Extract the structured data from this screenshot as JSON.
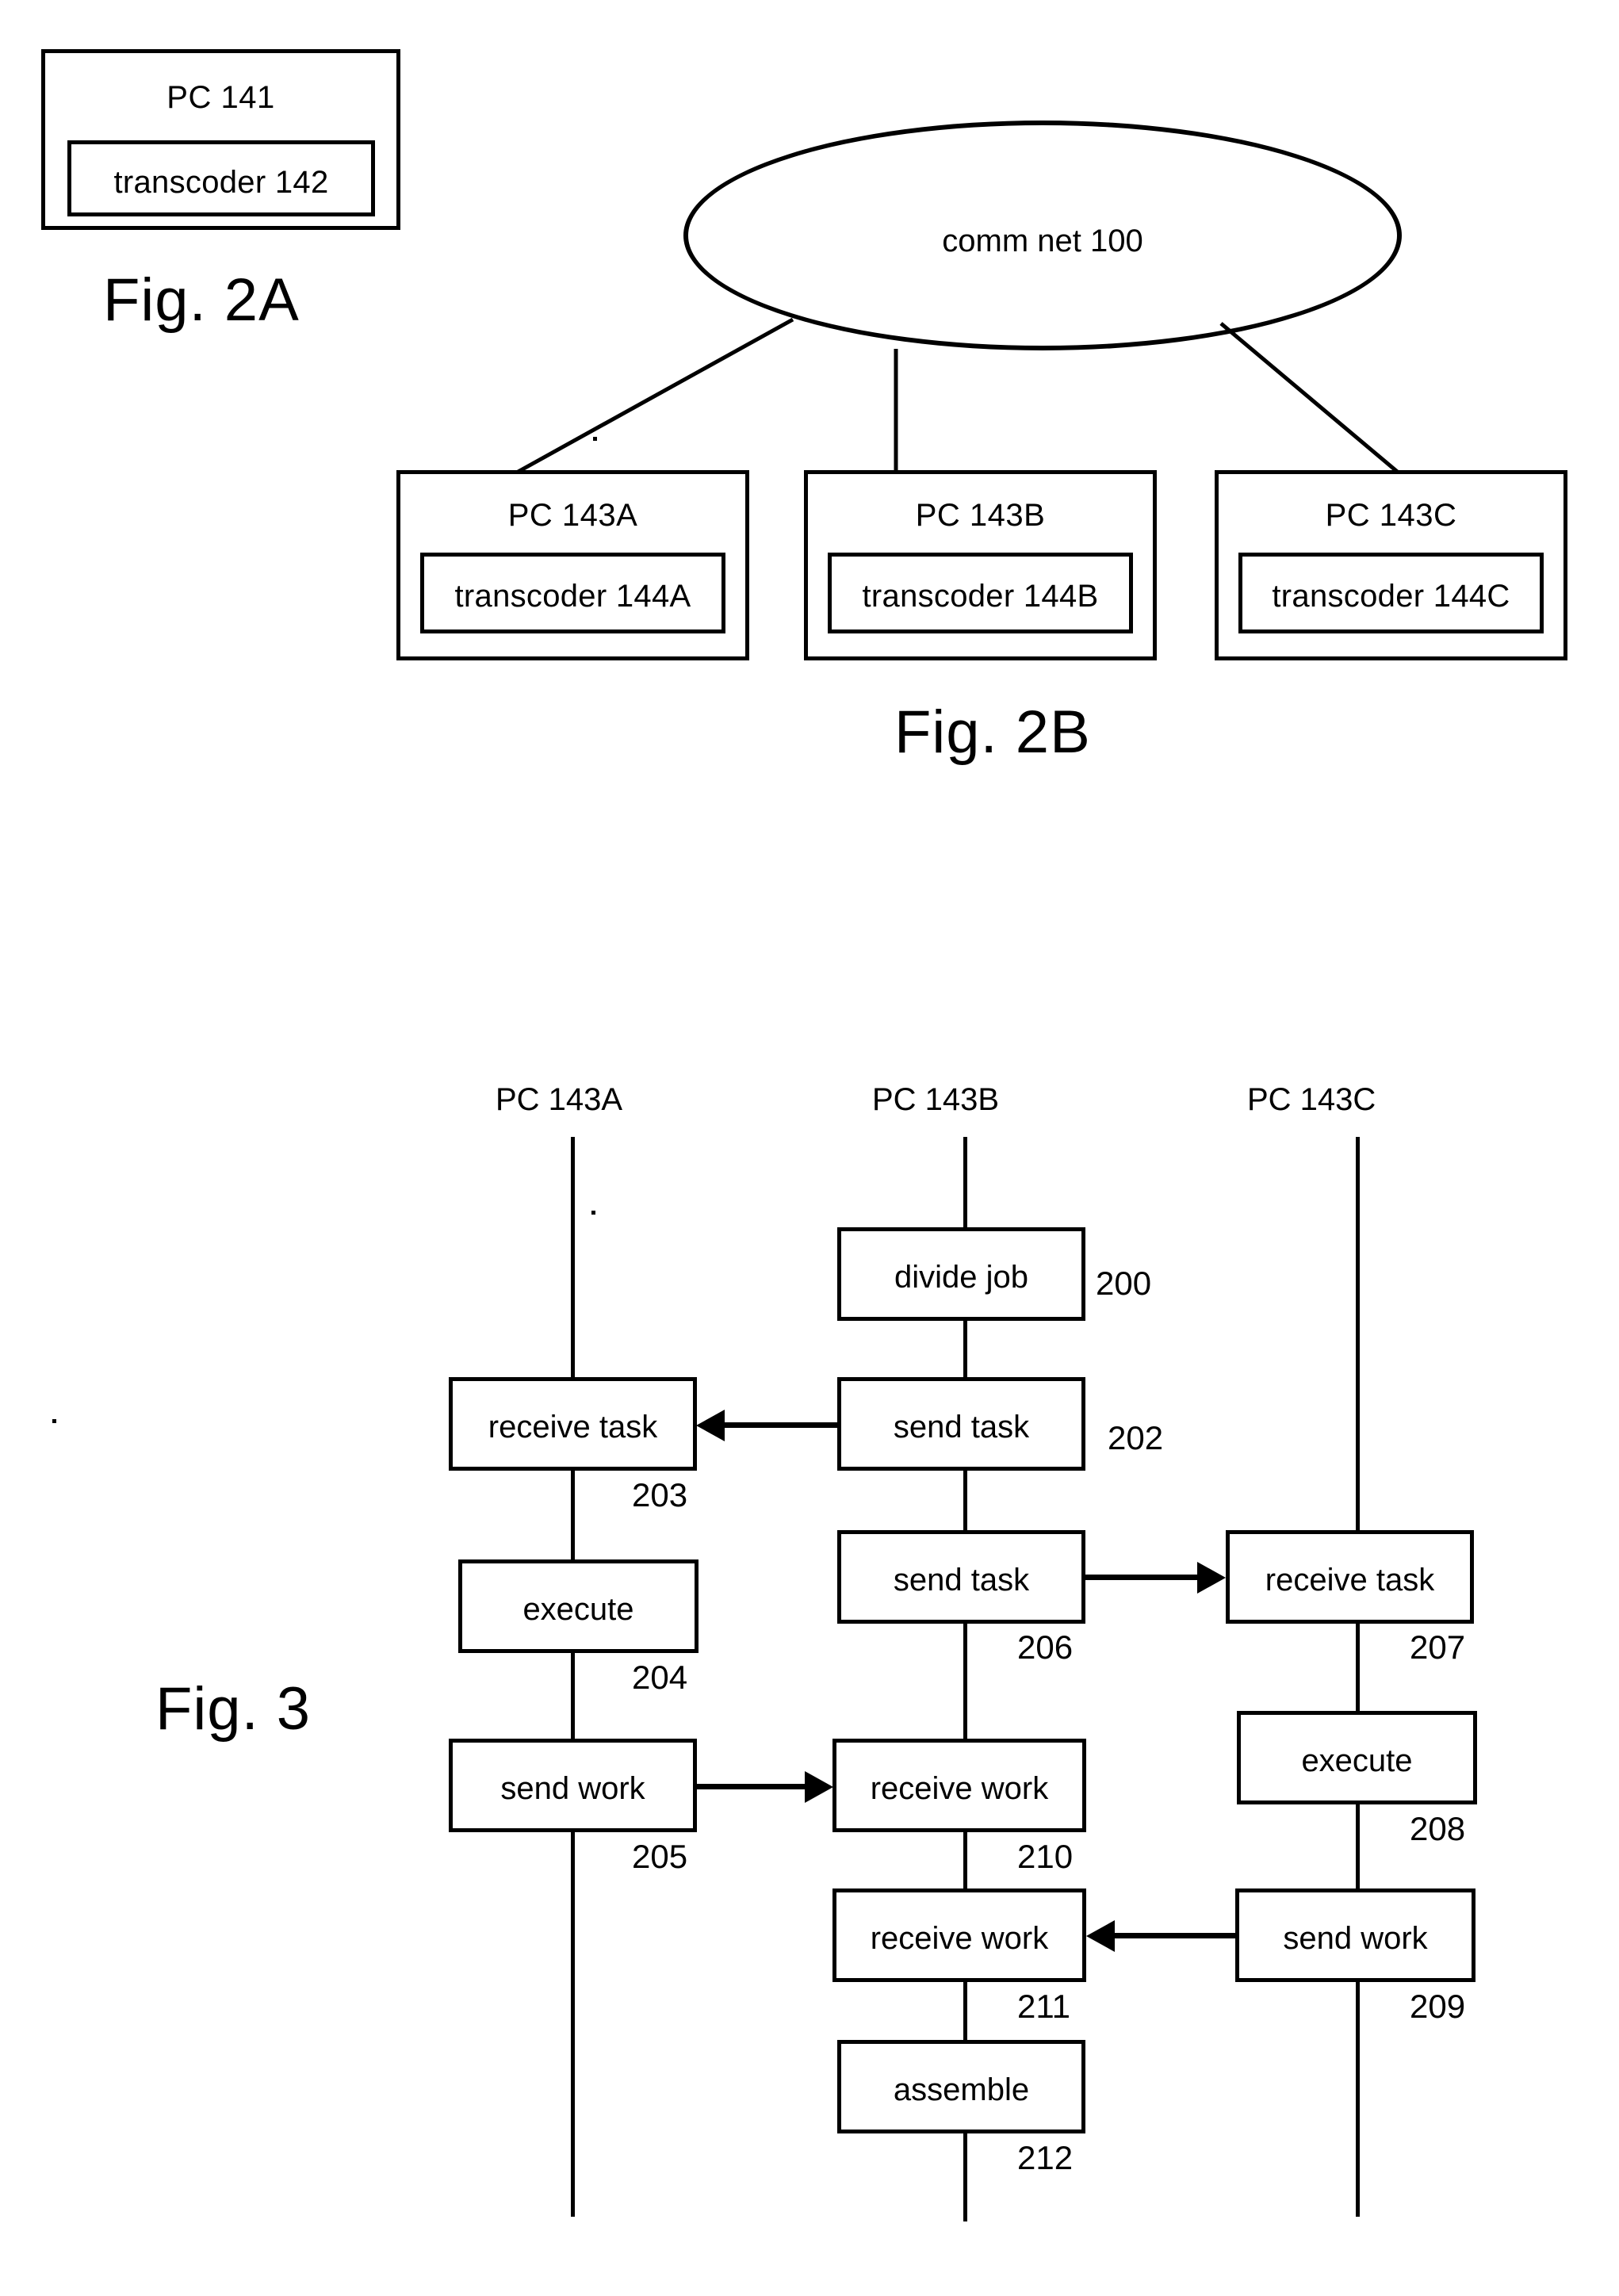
{
  "figures": {
    "fig2a": {
      "caption": "Fig. 2A",
      "pc": {
        "label": "PC 141"
      },
      "transcoder": {
        "label": "transcoder 142"
      }
    },
    "fig2b": {
      "caption": "Fig. 2B",
      "network": {
        "label": "comm net 100"
      },
      "nodes": [
        {
          "pc_label": "PC 143A",
          "transcoder_label": "transcoder 144A"
        },
        {
          "pc_label": "PC 143B",
          "transcoder_label": "transcoder 144B"
        },
        {
          "pc_label": "PC 143C",
          "transcoder_label": "transcoder 144C"
        }
      ]
    },
    "fig3": {
      "caption": "Fig. 3",
      "lifelines": [
        {
          "label": "PC 143A"
        },
        {
          "label": "PC 143B"
        },
        {
          "label": "PC 143C"
        }
      ],
      "steps": [
        {
          "label": "divide job",
          "ref": "200",
          "lifeline": "PC 143B"
        },
        {
          "label": "receive task",
          "ref": "203",
          "lifeline": "PC 143A"
        },
        {
          "label": "send task",
          "ref": "202",
          "lifeline": "PC 143B"
        },
        {
          "label": "execute",
          "ref": "204",
          "lifeline": "PC 143A"
        },
        {
          "label": "send task",
          "ref": "206",
          "lifeline": "PC 143B"
        },
        {
          "label": "receive task",
          "ref": "207",
          "lifeline": "PC 143C"
        },
        {
          "label": "send work",
          "ref": "205",
          "lifeline": "PC 143A"
        },
        {
          "label": "receive work",
          "ref": "210",
          "lifeline": "PC 143B"
        },
        {
          "label": "execute",
          "ref": "208",
          "lifeline": "PC 143C"
        },
        {
          "label": "receive work",
          "ref": "211",
          "lifeline": "PC 143B"
        },
        {
          "label": "send work",
          "ref": "209",
          "lifeline": "PC 143C"
        },
        {
          "label": "assemble",
          "ref": "212",
          "lifeline": "PC 143B"
        }
      ],
      "messages": [
        {
          "from": "send task 202",
          "to": "receive task 203",
          "direction": "left"
        },
        {
          "from": "send task 206",
          "to": "receive task 207",
          "direction": "right"
        },
        {
          "from": "send work 205",
          "to": "receive work 210",
          "direction": "right"
        },
        {
          "from": "send work 209",
          "to": "receive work 211",
          "direction": "left"
        }
      ]
    }
  },
  "colors": {
    "ink": "#000000",
    "paper": "#ffffff"
  }
}
